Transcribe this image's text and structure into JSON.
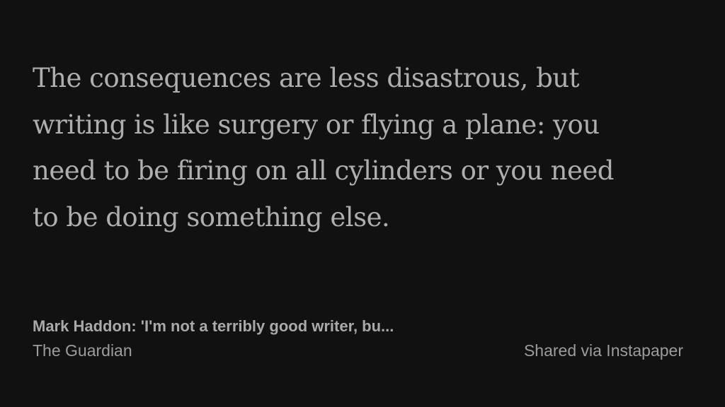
{
  "quote": {
    "lines": [
      "The consequences are less disastrous, but",
      "writing is like surgery or flying a plane: you",
      "need to be firing on all cylinders or you need",
      "to be doing something else."
    ]
  },
  "source": {
    "article_title": "Mark Haddon: 'I'm not a terribly good writer, bu...",
    "publication": "The Guardian"
  },
  "attribution": {
    "shared_via": "Shared via Instapaper"
  },
  "colors": {
    "background": "#111112",
    "quote_text": "#aeaeae",
    "meta_text": "#a9a9a9"
  }
}
